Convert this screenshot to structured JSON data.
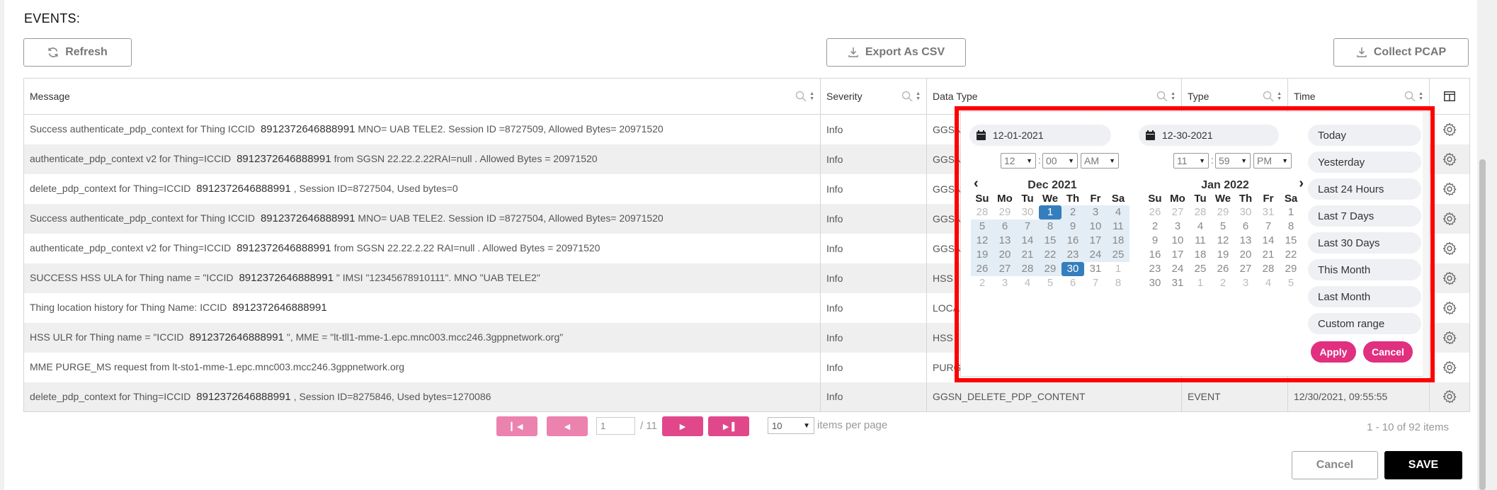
{
  "section_title": "EVENTS:",
  "toolbar": {
    "refresh": "Refresh",
    "export_csv": "Export As CSV",
    "collect_pcap": "Collect PCAP"
  },
  "columns": [
    "Message",
    "Severity",
    "Data Type",
    "Type",
    "Time"
  ],
  "rows": [
    {
      "pre": "Success authenticate_pdp_context for Thing ICCID",
      "iccid": "8912372646888991",
      "post": "MNO= UAB TELE2. Session ID =8727509, Allowed Bytes= 20971520",
      "severity": "Info",
      "data_type": "GGSN",
      "type": "",
      "time": ""
    },
    {
      "pre": "authenticate_pdp_context v2 for Thing=ICCID",
      "iccid": "8912372646888991",
      "post": "from SGSN 22.22.2.22RAI=null . Allowed Bytes = 20971520",
      "severity": "Info",
      "data_type": "GGSN",
      "type": "",
      "time": ""
    },
    {
      "pre": "delete_pdp_context for Thing=ICCID",
      "iccid": "8912372646888991",
      "post": ", Session ID=8727504, Used bytes=0",
      "severity": "Info",
      "data_type": "GGSN",
      "type": "",
      "time": ""
    },
    {
      "pre": "Success authenticate_pdp_context for Thing ICCID",
      "iccid": "8912372646888991",
      "post": "MNO= UAB TELE2. Session ID =8727504, Allowed Bytes= 20971520",
      "severity": "Info",
      "data_type": "GGSN",
      "type": "",
      "time": ""
    },
    {
      "pre": "authenticate_pdp_context v2 for Thing=ICCID",
      "iccid": "8912372646888991",
      "post": "from SGSN 22.22.2.22 RAI=null . Allowed Bytes = 20971520",
      "severity": "Info",
      "data_type": "GGSN",
      "type": "",
      "time": ""
    },
    {
      "pre": "SUCCESS HSS ULA for Thing name = \"ICCID",
      "iccid": "8912372646888991",
      "post": "\" IMSI \"12345678910111\". MNO \"UAB TELE2\"",
      "severity": "Info",
      "data_type": "HSS",
      "type": "",
      "time": ""
    },
    {
      "pre": "Thing location history for Thing Name: ICCID",
      "iccid": "8912372646888991",
      "post": "",
      "severity": "Info",
      "data_type": "LOCA",
      "type": "",
      "time": ""
    },
    {
      "pre": "HSS ULR for Thing name = \"ICCID",
      "iccid": "8912372646888991",
      "post": "\", MME = \"lt-tll1-mme-1.epc.mnc003.mcc246.3gppnetwork.org\"",
      "severity": "Info",
      "data_type": "HSS",
      "type": "",
      "time": ""
    },
    {
      "pre": "MME PURGE_MS request from lt-sto1-mme-1.epc.mnc003.mcc246.3gppnetwork.org",
      "iccid": "",
      "post": "",
      "severity": "Info",
      "data_type": "PURG",
      "type": "",
      "time": ""
    },
    {
      "pre": "delete_pdp_context for Thing=ICCID",
      "iccid": "8912372646888991",
      "post": ", Session ID=8275846, Used bytes=1270086",
      "severity": "Info",
      "data_type": "GGSN_DELETE_PDP_CONTENT",
      "type": "EVENT",
      "time": "12/30/2021, 09:55:55"
    }
  ],
  "pagination": {
    "page": "1",
    "total": "/ 11",
    "per_page": "10",
    "per_page_label": "items per page",
    "count": "1 - 10 of 92 items"
  },
  "footer": {
    "cancel": "Cancel",
    "save": "SAVE"
  },
  "picker": {
    "start_date": "12-01-2021",
    "end_date": "12-30-2021",
    "start_time": {
      "hour": "12",
      "minute": "00",
      "ampm": "AM"
    },
    "end_time": {
      "hour": "11",
      "minute": "59",
      "ampm": "PM"
    },
    "left_month": "Dec 2021",
    "right_month": "Jan 2022",
    "dow": [
      "Su",
      "Mo",
      "Tu",
      "We",
      "Th",
      "Fr",
      "Sa"
    ],
    "left_days": [
      [
        "28",
        "29",
        "30",
        "1",
        "2",
        "3",
        "4"
      ],
      [
        "5",
        "6",
        "7",
        "8",
        "9",
        "10",
        "11"
      ],
      [
        "12",
        "13",
        "14",
        "15",
        "16",
        "17",
        "18"
      ],
      [
        "19",
        "20",
        "21",
        "22",
        "23",
        "24",
        "25"
      ],
      [
        "26",
        "27",
        "28",
        "29",
        "30",
        "31",
        "1"
      ],
      [
        "2",
        "3",
        "4",
        "5",
        "6",
        "7",
        "8"
      ]
    ],
    "right_days": [
      [
        "26",
        "27",
        "28",
        "29",
        "30",
        "31",
        "1"
      ],
      [
        "2",
        "3",
        "4",
        "5",
        "6",
        "7",
        "8"
      ],
      [
        "9",
        "10",
        "11",
        "12",
        "13",
        "14",
        "15"
      ],
      [
        "16",
        "17",
        "18",
        "19",
        "20",
        "21",
        "22"
      ],
      [
        "23",
        "24",
        "25",
        "26",
        "27",
        "28",
        "29"
      ],
      [
        "30",
        "31",
        "1",
        "2",
        "3",
        "4",
        "5"
      ]
    ],
    "ranges": [
      "Today",
      "Yesterday",
      "Last 24 Hours",
      "Last 7 Days",
      "Last 30 Days",
      "This Month",
      "Last Month",
      "Custom range"
    ],
    "apply": "Apply",
    "cancel": "Cancel"
  },
  "colors": {
    "accent": "#e0307f",
    "selected": "#357ebd",
    "highlight_frame": "#ff0000"
  }
}
